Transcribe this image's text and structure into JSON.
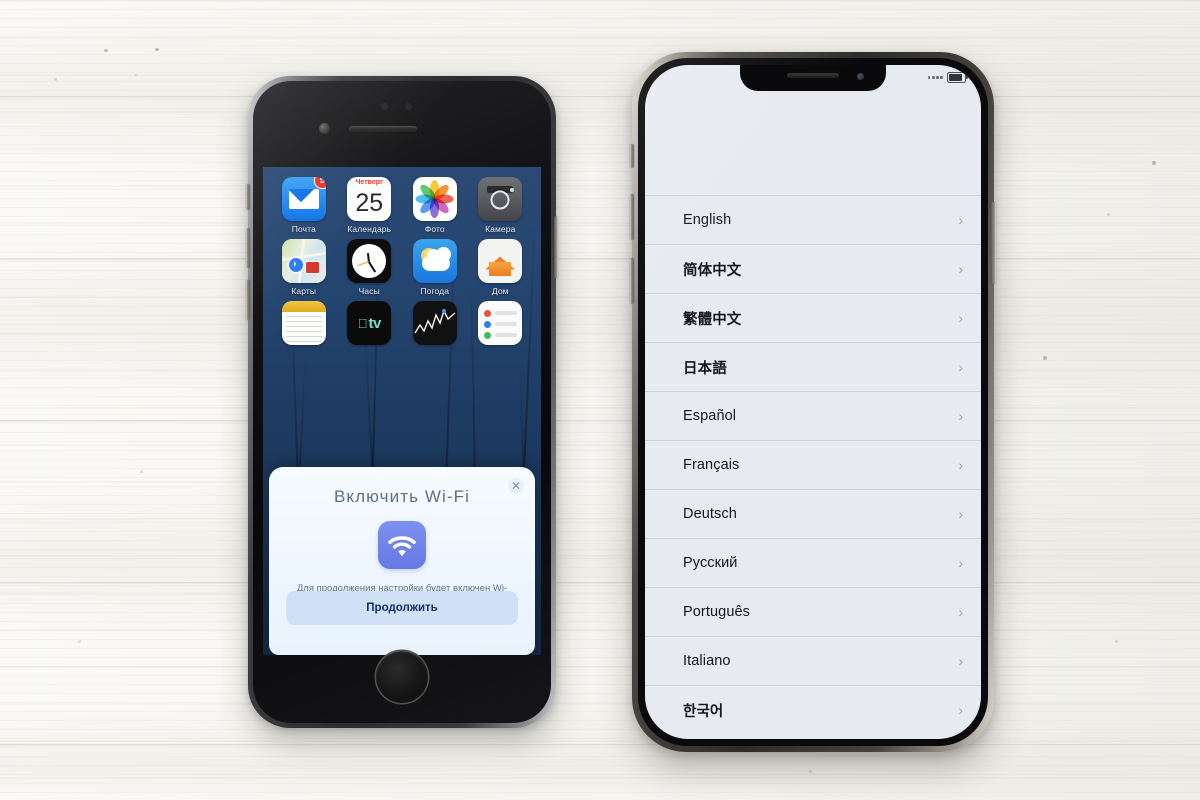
{
  "scene": {
    "description": "Two iPhones lying on a whitewashed wooden surface",
    "background_color": "#f5f4f0"
  },
  "left_phone": {
    "device_name": "iphone-8-space-gray",
    "status_bar": {},
    "home_screen": {
      "apps": [
        {
          "name": "Почта",
          "icon": "mail-icon",
          "badge": "5"
        },
        {
          "name": "Календарь",
          "icon": "calendar-icon",
          "weekday": "Четверг",
          "day": "25"
        },
        {
          "name": "Фото",
          "icon": "photos-icon"
        },
        {
          "name": "Камера",
          "icon": "camera-icon"
        },
        {
          "name": "Карты",
          "icon": "maps-icon"
        },
        {
          "name": "Часы",
          "icon": "clock-icon"
        },
        {
          "name": "Погода",
          "icon": "weather-icon"
        },
        {
          "name": "Дом",
          "icon": "home-icon"
        },
        {
          "name": "",
          "icon": "notes-icon"
        },
        {
          "name": "",
          "icon": "apple-tv-icon",
          "label_text": "tv"
        },
        {
          "name": "",
          "icon": "stocks-icon"
        },
        {
          "name": "",
          "icon": "reminders-icon"
        }
      ]
    },
    "wifi_modal": {
      "title": "Включить Wi-Fi",
      "close_label": "✕",
      "icon": "wifi-icon",
      "icon_color": "#6f83e8",
      "body_text": "Для продолжения настройки будет включен Wi-Fi.",
      "button_label": "Продолжить",
      "button_color": "#cfe0f7",
      "button_text_color": "#13306b"
    },
    "home_button": "home-button"
  },
  "right_phone": {
    "device_name": "iphone-x-silver",
    "status_bar": {
      "signal": "signal-dots-icon",
      "battery": "battery-icon"
    },
    "setup_screen": {
      "languages": [
        {
          "label": "English",
          "script": "latin"
        },
        {
          "label": "简体中文",
          "script": "cjk"
        },
        {
          "label": "繁體中文",
          "script": "cjk"
        },
        {
          "label": "日本語",
          "script": "cjk"
        },
        {
          "label": "Español",
          "script": "latin"
        },
        {
          "label": "Français",
          "script": "latin"
        },
        {
          "label": "Deutsch",
          "script": "latin"
        },
        {
          "label": "Русский",
          "script": "cyrillic"
        },
        {
          "label": "Português",
          "script": "latin"
        },
        {
          "label": "Italiano",
          "script": "latin"
        },
        {
          "label": "한국어",
          "script": "cjk"
        }
      ],
      "chevron": "›"
    }
  }
}
